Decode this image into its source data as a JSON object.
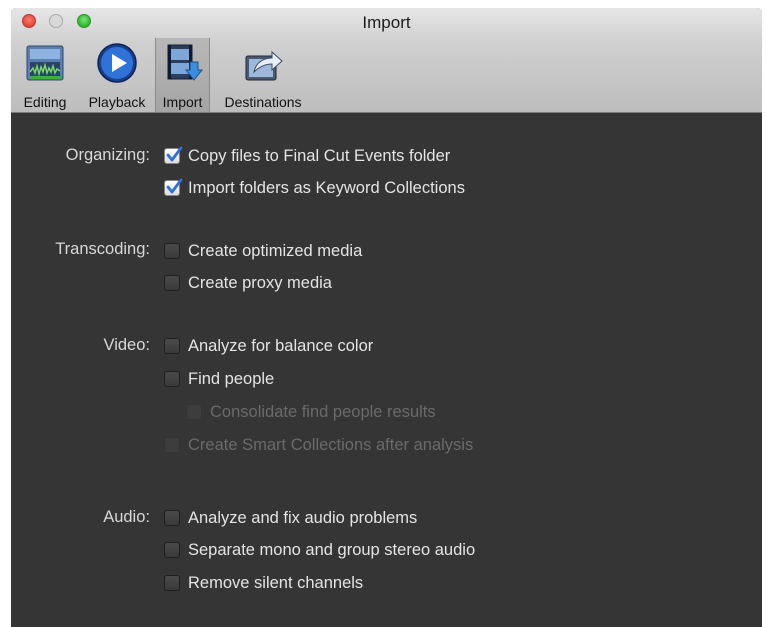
{
  "window": {
    "title": "Import"
  },
  "toolbar": {
    "items": [
      {
        "label": "Editing",
        "icon": "editing-icon"
      },
      {
        "label": "Playback",
        "icon": "playback-icon"
      },
      {
        "label": "Import",
        "icon": "import-icon",
        "selected": true
      },
      {
        "label": "Destinations",
        "icon": "destinations-icon"
      }
    ]
  },
  "sections": {
    "organizing": {
      "label": "Organizing:",
      "options": [
        {
          "label": "Copy files to Final Cut Events folder",
          "checked": true
        },
        {
          "label": "Import folders as Keyword Collections",
          "checked": true
        }
      ]
    },
    "transcoding": {
      "label": "Transcoding:",
      "options": [
        {
          "label": "Create optimized media",
          "checked": false
        },
        {
          "label": "Create proxy media",
          "checked": false
        }
      ]
    },
    "video": {
      "label": "Video:",
      "options": [
        {
          "label": "Analyze for balance color",
          "checked": false
        },
        {
          "label": "Find people",
          "checked": false
        },
        {
          "label": "Consolidate find people results",
          "checked": false,
          "disabled": true
        },
        {
          "label": "Create Smart Collections after analysis",
          "checked": false,
          "disabled": true
        }
      ]
    },
    "audio": {
      "label": "Audio:",
      "options": [
        {
          "label": "Analyze and fix audio problems",
          "checked": false
        },
        {
          "label": "Separate mono and group stereo audio",
          "checked": false
        },
        {
          "label": "Remove silent channels",
          "checked": false
        }
      ]
    }
  },
  "colors": {
    "background": "#353535",
    "text": "#e4e4e4",
    "disabled_text": "#6a6a6a",
    "check_accent": "#2f6fd6"
  }
}
